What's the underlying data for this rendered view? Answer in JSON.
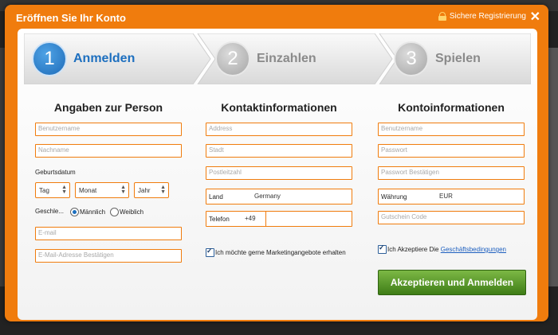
{
  "modal": {
    "title": "Eröffnen Sie Ihr Konto",
    "secure_label": "Sichere Registrierung",
    "close_glyph": "✕"
  },
  "steps": [
    {
      "num": "1",
      "label": "Anmelden",
      "active": true
    },
    {
      "num": "2",
      "label": "Einzahlen",
      "active": false
    },
    {
      "num": "3",
      "label": "Spielen",
      "active": false
    }
  ],
  "personal": {
    "title": "Angaben zur Person",
    "username_placeholder": "Benutzername",
    "lastname_placeholder": "Nachname",
    "birthdate_label": "Geburtsdatum",
    "day": "Tag",
    "month": "Monat",
    "year": "Jahr",
    "gender_label": "Geschle...",
    "male": "Männlich",
    "female": "Weiblich",
    "email_placeholder": "E-mail",
    "email_confirm_placeholder": "E-Mail-Adresse Bestätigen"
  },
  "contact": {
    "title": "Kontaktinformationen",
    "address_placeholder": "Address",
    "city_placeholder": "Stadt",
    "zip_placeholder": "Postleitzahl",
    "country_label": "Land",
    "country_value": "Germany",
    "phone_label": "Telefon",
    "phone_prefix": "+49",
    "marketing_text": "Ich möchte gerne Marketingangebote erhalten"
  },
  "account": {
    "title": "Kontoinformationen",
    "username_placeholder": "Benutzername",
    "password_placeholder": "Passwort",
    "password_confirm_placeholder": "Passwort Bestätigen",
    "currency_label": "Währung",
    "currency_value": "EUR",
    "voucher_placeholder": "Gutschein Code",
    "terms_prefix": "Ich Akzeptiere Die",
    "terms_link": "Geschäftsbedingungen",
    "submit_label": "Akzeptieren und Anmelden"
  },
  "colors": {
    "accent": "#f07c0d",
    "active_step": "#1d6fbf",
    "button": "#4f8f22"
  }
}
